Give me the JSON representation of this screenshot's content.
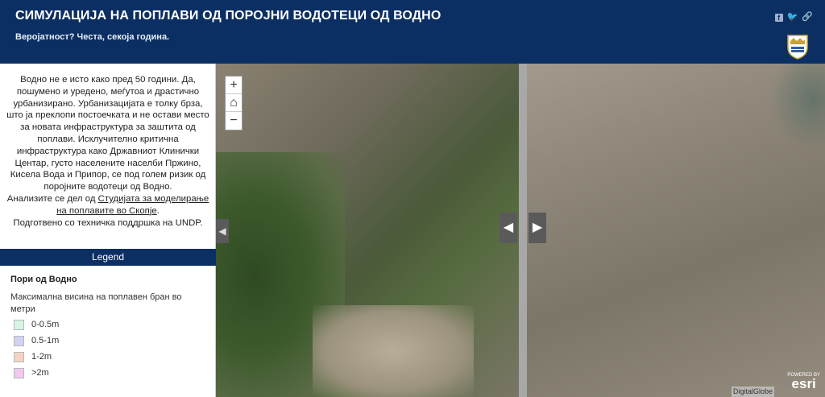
{
  "header": {
    "title": "СИМУЛАЦИЈА НА ПОПЛАВИ ОД ПОРОЈНИ ВОДОТЕЦИ ОД ВОДНО",
    "subtitle": "Веројатност? Честа, секоја година.",
    "share_icons": [
      "facebook-icon",
      "twitter-icon",
      "link-icon"
    ]
  },
  "description": {
    "text": "Водно не е исто како пред 50 години. Да, пошумено и уредено, меѓутоа и драстично урбанизирано. Урбанизацијата е толку брза, што ја преклопи постоечката и не остави место за новата инфраструктура за заштита од поплави. Исклучително критична инфраструктура како Државниот Клинички Центар, густо населените населби Пржино, Кисела Вода и Припор, се под голем ризик од поројните водотеци од Водно.",
    "analysis_prefix": "Анализите се дел од ",
    "link_text": "Студијата за моделирање на поплавите во Скопје",
    "analysis_suffix": ".",
    "support": "Подготвено со техничка поддршка на UNDP."
  },
  "legend": {
    "header": "Legend",
    "layer_title": "Пори од Водно",
    "field_title": "Максимална висина на поплавен бран во метри",
    "items": [
      {
        "label": "0-0.5m",
        "color": "#d6f5e6"
      },
      {
        "label": "0.5-1m",
        "color": "#cfd4f5"
      },
      {
        "label": "1-2m",
        "color": "#f6d3c4"
      },
      {
        "label": ">2m",
        "color": "#f2c8ee"
      }
    ]
  },
  "map": {
    "zoom_in": "+",
    "home": "⌂",
    "zoom_out": "−",
    "attribution": "DigitalGlobe",
    "esri_powered": "POWERED BY",
    "esri_logo": "esri"
  }
}
